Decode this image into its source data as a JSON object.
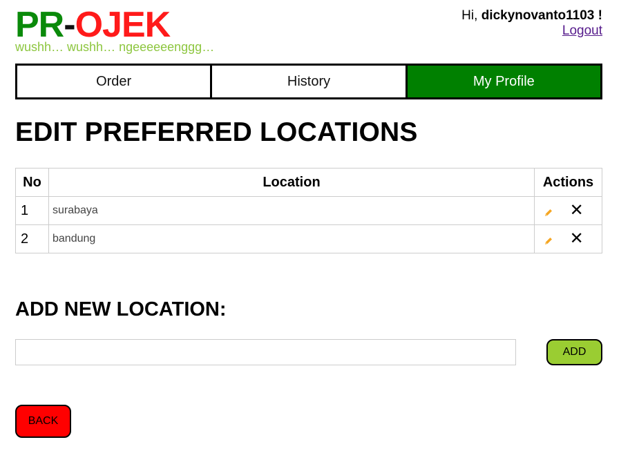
{
  "logo": {
    "part1": "PR",
    "dash": "-",
    "part2": "OJEK",
    "tagline": "wushh… wushh… ngeeeeeenggg…"
  },
  "user": {
    "greeting": "Hi,",
    "username": "dickynovanto1103",
    "exclaim": "!",
    "logout": "Logout"
  },
  "nav": {
    "tabs": [
      "Order",
      "History",
      "My Profile"
    ],
    "active": "My Profile"
  },
  "page": {
    "title": "EDIT PREFERRED LOCATIONS"
  },
  "table": {
    "headers": {
      "no": "No",
      "location": "Location",
      "actions": "Actions"
    },
    "rows": [
      {
        "no": "1",
        "location": "surabaya"
      },
      {
        "no": "2",
        "location": "bandung"
      }
    ]
  },
  "add_form": {
    "title": "ADD NEW LOCATION:",
    "input_value": "",
    "button": "ADD"
  },
  "back_button": "BACK",
  "colors": {
    "logo_green": "#0a8a0a",
    "logo_red": "#ff1a1a",
    "tagline": "#8dc63f",
    "active_tab": "#008000",
    "add_button": "#9acd32",
    "back_button": "#ff0000",
    "pencil": "#f5a623"
  }
}
